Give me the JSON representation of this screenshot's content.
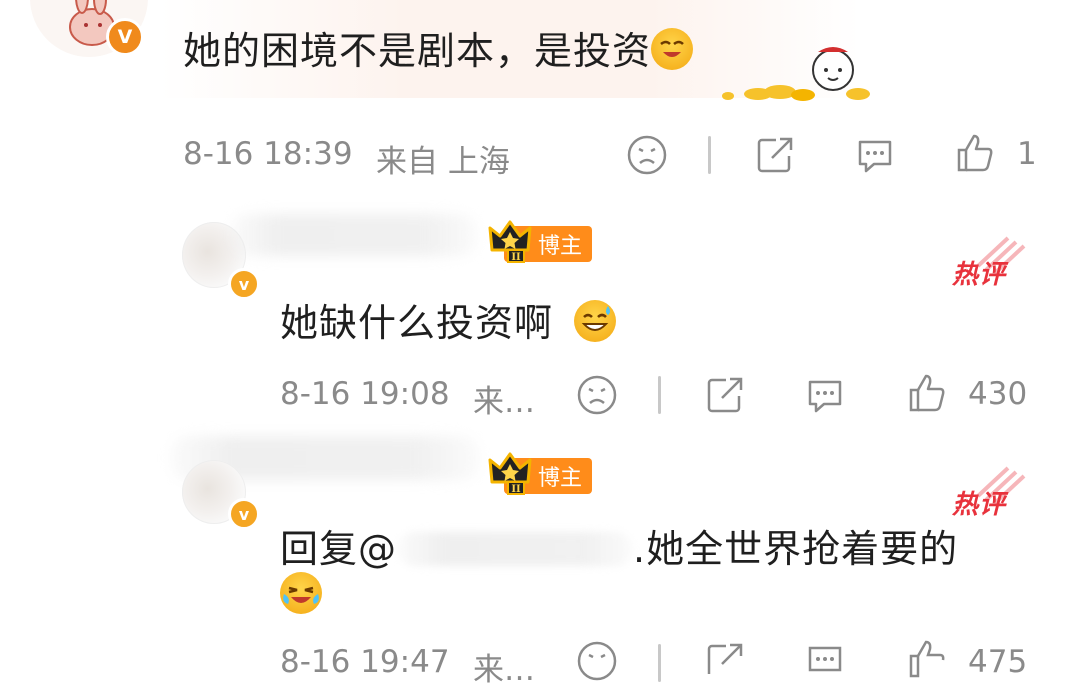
{
  "comment": {
    "text": "她的困境不是剧本，是投资",
    "time": "8-16 18:39",
    "source": "来自 上海",
    "like_count": "1",
    "verified_badge": "V"
  },
  "reply1": {
    "badge": "博主",
    "hot_tag": "热评",
    "text": "她缺什么投资啊",
    "time": "8-16 19:08",
    "source": "来…",
    "like_count": "430",
    "verified_badge": "v"
  },
  "reply2": {
    "badge": "博主",
    "hot_tag": "热评",
    "reply_prefix": "回复@",
    "text": ".她全世界抢着要的",
    "time": "8-16 19:47",
    "source": "来…",
    "like_count": "475",
    "verified_badge": "v"
  },
  "colors": {
    "badge_orange": "#ff8c1a",
    "hot_red": "#e8323c",
    "meta_gray": "#8a8a8a",
    "verified_orange": "#f5a623"
  },
  "icons": [
    "dislike-face-icon",
    "share-icon",
    "comment-icon",
    "thumbs-up-icon",
    "crown-icon",
    "laugh-emoji-icon",
    "sweat-smile-emoji-icon",
    "cry-laugh-emoji-icon",
    "coins-sticker-icon",
    "avatar-rabbit-icon"
  ]
}
